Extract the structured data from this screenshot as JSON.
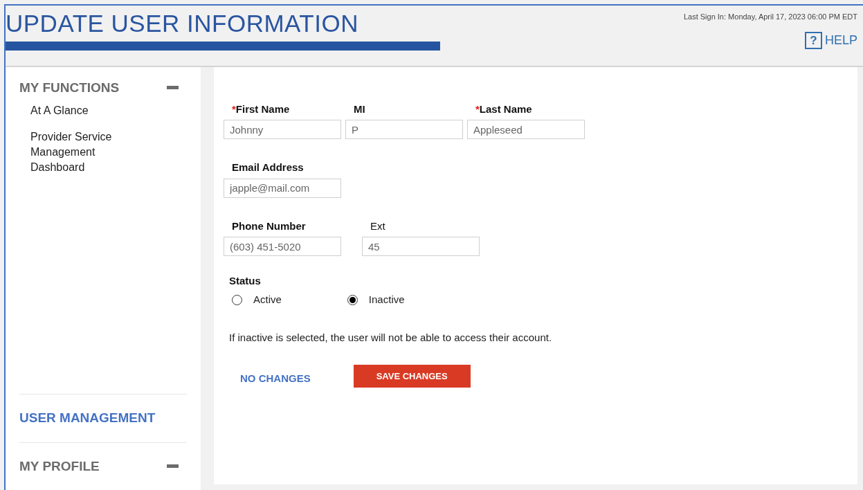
{
  "header": {
    "title": "UPDATE USER INFORMATION",
    "last_sign_in": "Last Sign In: Monday, April 17, 2023 06:00 PM EDT",
    "help": {
      "icon_glyph": "?",
      "label": "HELP"
    }
  },
  "sidebar": {
    "sections": [
      {
        "title": "MY FUNCTIONS",
        "kind": "collapsible",
        "expanded": true,
        "items": [
          "At A Glance",
          "Provider Service Management Dashboard"
        ]
      },
      {
        "title": "USER MANAGEMENT",
        "kind": "link",
        "selected": true
      },
      {
        "title": "MY PROFILE",
        "kind": "collapsible",
        "expanded": true
      }
    ]
  },
  "form": {
    "field_rows": [
      [
        {
          "label": "First Name",
          "required": true,
          "value": "Johnny"
        },
        {
          "label": "MI",
          "required": false,
          "value": "P"
        },
        {
          "label": "Last Name",
          "required": true,
          "value": "Appleseed"
        }
      ],
      [
        {
          "label": "Email Address",
          "required": false,
          "value": "japple@mail.com"
        }
      ],
      [
        {
          "label": "Phone Number",
          "required": false,
          "value": "(603) 451-5020"
        },
        {
          "label": "Ext",
          "required": false,
          "value": "45",
          "plain_label": true
        }
      ]
    ],
    "required_mark": "*",
    "status": {
      "label": "Status",
      "options": [
        {
          "label": "Active",
          "selected": false
        },
        {
          "label": "Inactive",
          "selected": true
        }
      ]
    },
    "note": "If inactive is selected, the user will not be able to access their account.",
    "buttons": [
      {
        "label": "NO CHANGES",
        "kind": "link"
      },
      {
        "label": "SAVE CHANGES",
        "kind": "primary"
      }
    ]
  }
}
